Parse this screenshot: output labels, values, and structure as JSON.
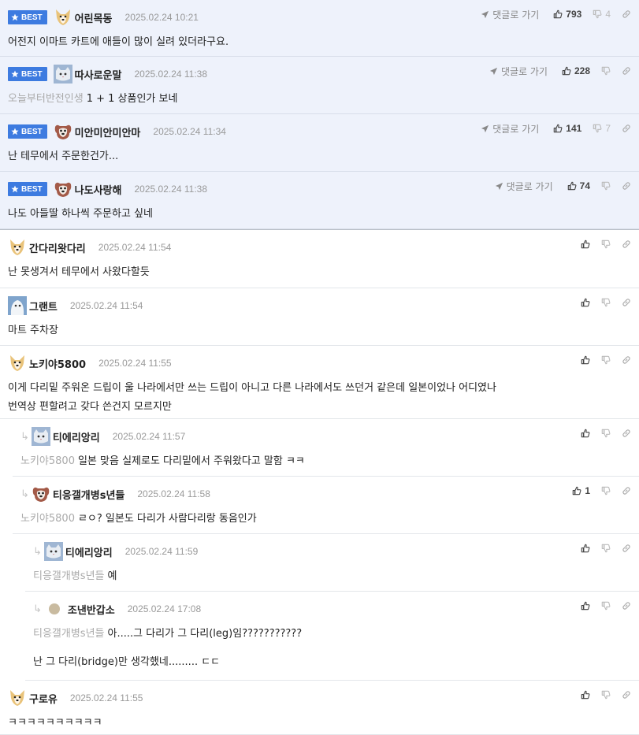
{
  "labels": {
    "best": "BEST",
    "go_reply": "댓글로 가기"
  },
  "comments": [
    {
      "nick": "어린목동",
      "date": "2025.02.24 10:21",
      "text": "어전지 이마트 카트에 애들이 많이 실려 있더라구요.",
      "up": "793",
      "down": "4",
      "best": true,
      "avatar": "dog-icon"
    },
    {
      "nick": "따사로운말",
      "date": "2025.02.24 11:38",
      "mention": "오늘부터반전인생",
      "text": "1 + 1 상품인가 보네",
      "up": "228",
      "down": "",
      "best": true,
      "avatar": "cat-icon"
    },
    {
      "nick": "미안미안미안마",
      "date": "2025.02.24 11:34",
      "text": "난 테무에서 주문한건가...",
      "up": "141",
      "down": "7",
      "best": true,
      "avatar": "puppy-icon"
    },
    {
      "nick": "나도사랑해",
      "date": "2025.02.24 11:38",
      "text": "나도 아들딸 하나씩 주문하고 싶네",
      "up": "74",
      "down": "",
      "best": true,
      "avatar": "puppy-icon"
    },
    {
      "nick": "간다리왓다리",
      "date": "2025.02.24 11:54",
      "text": "난 못생겨서 테무에서 사왔다할듯",
      "up": "",
      "down": "",
      "avatar": "dog-icon"
    },
    {
      "nick": "그랜트",
      "date": "2025.02.24 11:54",
      "text": "마트 주차장",
      "up": "",
      "down": "",
      "avatar": "bird-icon"
    },
    {
      "nick": "노키야5800",
      "date": "2025.02.24 11:55",
      "text": "이게 다리밑 주워온 드립이 울 나라에서만 쓰는 드립이 아니고 다른 나라에서도 쓰던거 같은데 일본이었나 어디였나",
      "text2": "번역상 편할려고 갖다 쓴건지 모르지만",
      "up": "",
      "down": "",
      "avatar": "dog-icon"
    },
    {
      "nick": "티에리앙리",
      "date": "2025.02.24 11:57",
      "mention": "노키야5800",
      "text": "일본 맞음 실제로도 다리밑에서 주워왔다고 말함 ㅋㅋ",
      "up": "",
      "down": "",
      "avatar": "cat-icon"
    },
    {
      "nick": "티응갤개병s년들",
      "date": "2025.02.24 11:58",
      "mention": "노키야5800",
      "text": "ㄹㅇ? 일본도 다리가 사람다리랑 동음인가",
      "up": "1",
      "down": "",
      "avatar": "puppy-icon"
    },
    {
      "nick": "티에리앙리",
      "date": "2025.02.24 11:59",
      "mention": "티응갤개병s년들",
      "text": "예",
      "up": "",
      "down": "",
      "avatar": "cat-icon"
    },
    {
      "nick": "조낸반갑소",
      "date": "2025.02.24 17:08",
      "mention": "티응갤개병s년들",
      "text": "아.....그 다리가 그 다리(leg)임???????????",
      "text2": "난 그 다리(bridge)만 생각했네......... ㄷㄷ",
      "up": "",
      "down": "",
      "avatar": "dot-avatar"
    },
    {
      "nick": "구로유",
      "date": "2025.02.24 11:55",
      "text": "ㅋㅋㅋㅋㅋㅋㅋㅋㅋㅋ",
      "up": "",
      "down": "",
      "avatar": "dog-icon"
    }
  ]
}
